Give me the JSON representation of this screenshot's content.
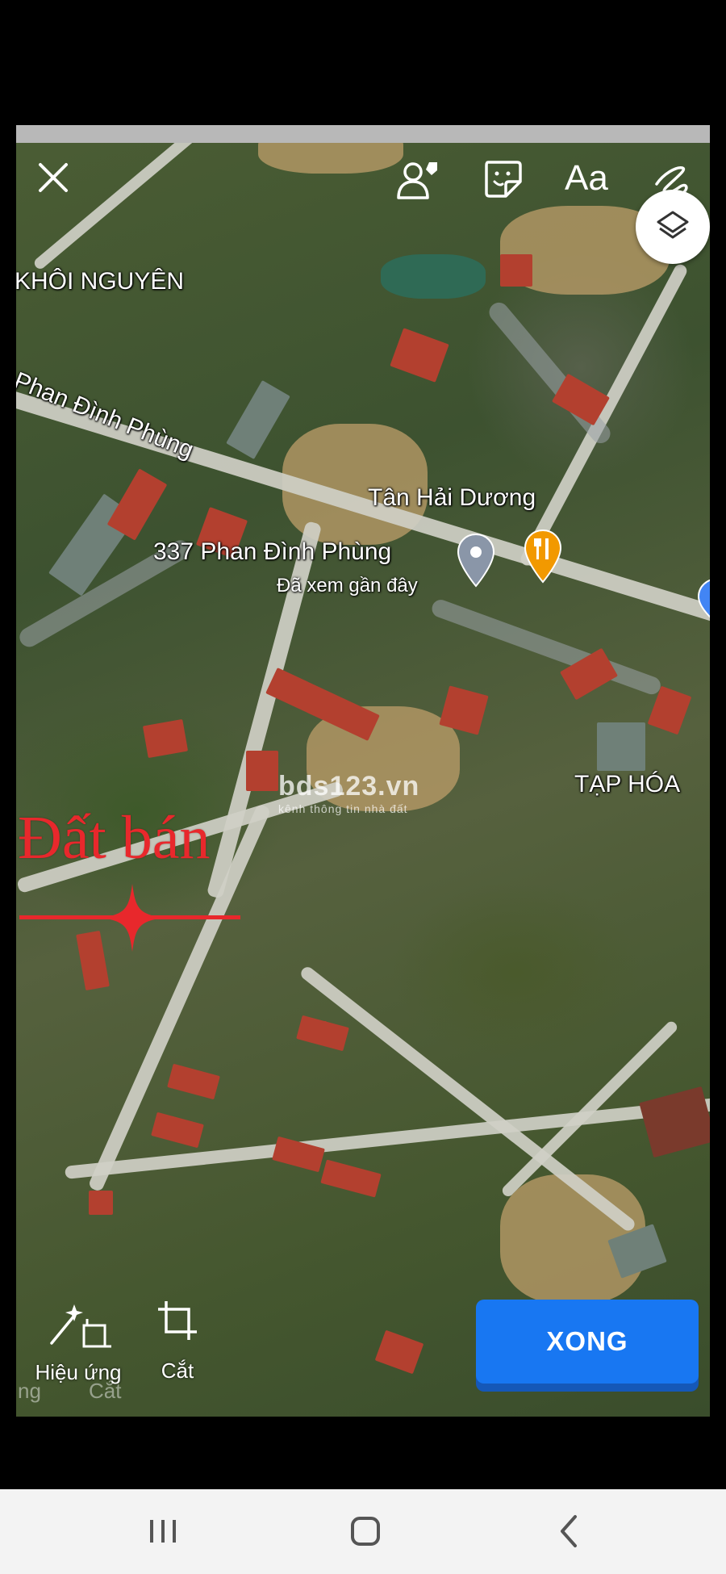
{
  "map": {
    "places": {
      "khoi_nguyen": "KHÔI NGUYÊN",
      "street": "Phan Đình Phùng",
      "tan_hai_duong": "Tân Hải Dương",
      "address": "337 Phan Đình Phùng",
      "recent_note": "Đã xem gần đây",
      "tap_hoa": "TẠP HÓA"
    }
  },
  "watermark": {
    "main": "bds123.vn",
    "sub": "kênh thông tin nhà đất"
  },
  "annotation": {
    "text": "Đất bán",
    "color": "#e8282c"
  },
  "toolbar": {
    "text_tool": "Aa",
    "effects_label": "Hiệu ứng",
    "crop_label": "Cắt"
  },
  "ghost_labels": {
    "left": "ng",
    "right": "Cắt"
  },
  "done_button": {
    "label": "XONG",
    "color": "#1877f2"
  },
  "icons": [
    "close-icon",
    "tag-people-icon",
    "sticker-icon",
    "draw-icon",
    "layers-icon",
    "restaurant-pin-icon",
    "location-pin-icon",
    "sparkle-icon",
    "effects-icon",
    "crop-icon",
    "recents-icon",
    "home-icon",
    "back-icon"
  ]
}
